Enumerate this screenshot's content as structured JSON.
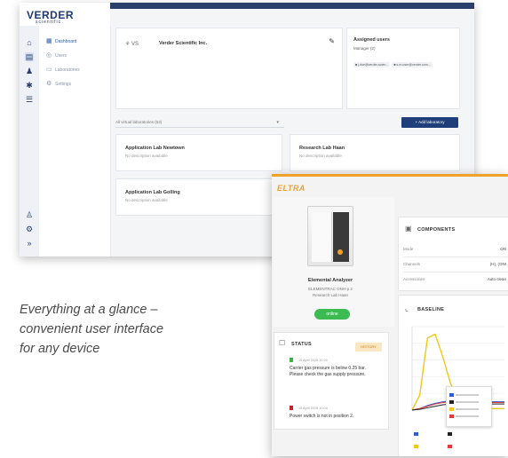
{
  "dashboard": {
    "logo_text": "VERDER",
    "logo_sub": "scientific",
    "nav_items": [
      {
        "label": "Dashboard",
        "icon": "grid-icon"
      },
      {
        "label": "Users",
        "icon": "user-icon"
      },
      {
        "label": "Laboratories",
        "icon": "lab-icon"
      },
      {
        "label": "Settings",
        "icon": "gear-icon"
      }
    ],
    "company_card": {
      "logo_label": "VS",
      "name": "Verder Scientific Inc."
    },
    "assigned_users": {
      "title": "Assigned users",
      "role": "Manager (2)",
      "chips": [
        "■ j.doe@verder-scien...",
        "■ s.m.user@verder.com..."
      ]
    },
    "lab_filter": {
      "value": "All virtual laboratories (53)"
    },
    "add_button": "+ Add laboratory",
    "labs": [
      {
        "name": "Application Lab Newtown",
        "desc": "No description available"
      },
      {
        "name": "Research Lab Haan",
        "desc": "No description available"
      },
      {
        "name": "Application Lab Golling",
        "desc": "No description available"
      }
    ]
  },
  "eltra": {
    "logo": "ELTRA",
    "device": {
      "name": "Elemental Analyzer",
      "model": "ELEMENTRAC ONH-p 2",
      "location": "Research Lab Haan",
      "status": "online"
    },
    "status_panel": {
      "title": "STATUS",
      "history_label": "HISTORY",
      "messages": [
        {
          "date": "10 April 2025 10:24",
          "text": "Carrier gas pressure is below 0.25 bar. Please check the gas supply pressure.",
          "color": "#39b54a"
        },
        {
          "date": "10 April 2025 10:04",
          "text": "Power switch is not in position 2.",
          "color": "#c0282d"
        }
      ]
    },
    "components": {
      "title": "COMPONENTS",
      "rows": [
        {
          "label": "Mode",
          "value": "ON"
        },
        {
          "label": "Channels",
          "value": "(H), (ONI"
        },
        {
          "label": "Accessories",
          "value": "Auto clean"
        }
      ]
    },
    "baseline": {
      "title": "BASELINE"
    },
    "chart_data": {
      "type": "line",
      "title": "BASELINE",
      "x": [
        0,
        1,
        2,
        3,
        4,
        5,
        6,
        7,
        8,
        9,
        10,
        11,
        12
      ],
      "series": [
        {
          "color": "#f5c518",
          "values": [
            0,
            20,
            95,
            100,
            70,
            35,
            12,
            5,
            3,
            2,
            2,
            2,
            2
          ]
        },
        {
          "color": "#2e5bd8",
          "values": [
            0,
            2,
            6,
            9,
            11,
            12,
            12,
            12,
            11,
            11,
            11,
            11,
            11
          ]
        },
        {
          "color": "#e53935",
          "values": [
            0,
            2,
            5,
            8,
            10,
            11,
            11,
            11,
            10,
            10,
            10,
            10,
            10
          ]
        },
        {
          "color": "#222222",
          "values": [
            0,
            1,
            3,
            5,
            7,
            8,
            8,
            8,
            8,
            8,
            8,
            8,
            8
          ]
        }
      ],
      "legend_colors": [
        "#2e5bd8",
        "#222222",
        "#f5c518",
        "#e53935"
      ],
      "ylim": [
        0,
        110
      ]
    }
  },
  "caption": {
    "line1": "Everything at a glance –",
    "line2": "convenient user interface",
    "line3": "for any device"
  }
}
